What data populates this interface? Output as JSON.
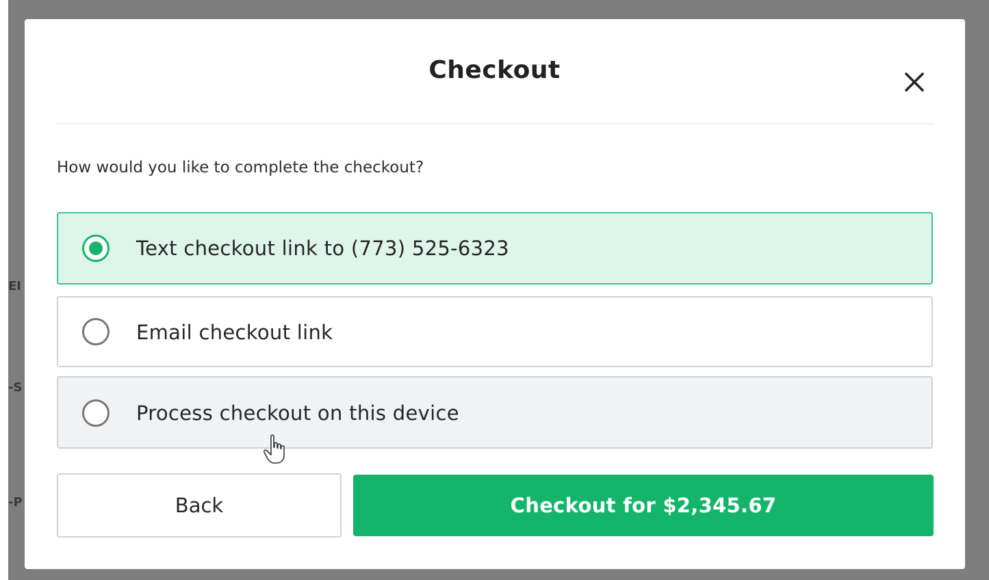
{
  "backdrop": {
    "fragments": [
      "EI",
      "-S",
      "-P"
    ]
  },
  "modal": {
    "title": "Checkout",
    "close_icon": "close-icon",
    "prompt": "How would you like to complete the checkout?",
    "options": [
      {
        "label": "Text checkout link to (773) 525-6323",
        "selected": true
      },
      {
        "label": "Email checkout link",
        "selected": false
      },
      {
        "label": "Process checkout on this device",
        "selected": false
      }
    ],
    "back_label": "Back",
    "checkout_label": "Checkout for $2,345.67"
  },
  "colors": {
    "accent": "#15b46b",
    "selected_bg": "#ddf5ea",
    "selected_border": "#3fc48a",
    "overlay": "#7d7d7d"
  },
  "cursor_icon": "pointer-hand-icon"
}
